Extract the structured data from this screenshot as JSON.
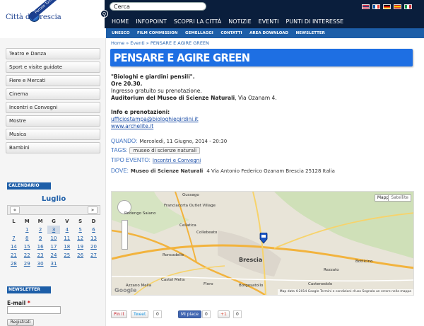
{
  "header": {
    "logo_text": "Città di   Brescia",
    "logo_ribbon": "Portale Turistico",
    "search_value": "Cerca",
    "languages": [
      "English",
      "Français",
      "Deutsch",
      "Español",
      "Italiano"
    ],
    "nav": [
      "HOME",
      "INFOPOINT",
      "SCOPRI LA CITTÀ",
      "NOTIZIE",
      "EVENTI",
      "PUNTI DI INTERESSE"
    ]
  },
  "subnav": [
    "UNESCO",
    "FILM COMMISSION",
    "GEMELLAGGI",
    "CONTATTI",
    "AREA DOWNLOAD",
    "NEWSLETTER"
  ],
  "breadcrumb": "Home » Eventi » PENSARE E AGIRE GREEN",
  "sidebar": {
    "menu": [
      "Teatro e Danza",
      "Sport e visite guidate",
      "Fiere e Mercati",
      "Cinema",
      "Incontri e Convegni",
      "Mostre",
      "Musica",
      "Bambini"
    ],
    "calendar_heading": "CALENDARIO",
    "month": "Luglio",
    "prev": "«",
    "next": "»",
    "weekdays": [
      "L",
      "M",
      "M",
      "G",
      "V",
      "S",
      "D"
    ],
    "weeks": [
      [
        "",
        "1",
        "2",
        "3",
        "4",
        "5",
        "6"
      ],
      [
        "7",
        "8",
        "9",
        "10",
        "11",
        "12",
        "13"
      ],
      [
        "14",
        "15",
        "16",
        "17",
        "18",
        "19",
        "20"
      ],
      [
        "21",
        "22",
        "23",
        "24",
        "25",
        "26",
        "27"
      ],
      [
        "28",
        "29",
        "30",
        "31",
        "",
        "",
        ""
      ]
    ],
    "newsletter_heading": "NEWSLETTER",
    "email_label": "E-mail",
    "email_required": "*",
    "register_label": "Registrati"
  },
  "event": {
    "title": "PENSARE E AGIRE GREEN",
    "line1": "\"Biologhi e giardini pensili\".",
    "line2": "Ore 20.30.",
    "line3": "Ingresso gratuito su prenotazione.",
    "venue_bold": "Auditorium del Museo di Scienze Naturali",
    "venue_rest": ", Via Ozanam 4.",
    "info_heading": "Info e prenotazioni:",
    "email": "ufficiostampa@biologhiegirdini.it",
    "website": "www.archelite.it",
    "when_label": "QUANDO:",
    "when_value": "Mercoledì, 11 Giugno, 2014 - 20:30",
    "tags_label": "TAGS:",
    "tag": "museo di scienze naturali",
    "type_label": "TIPO EVENTO:",
    "type_value": "Incontri e Convegni",
    "where_label": "DOVE:",
    "where_place": "Museo di Scienze Naturali",
    "where_address": "4 Via Antonio Federico Ozanam Brescia  25128 Italia"
  },
  "map": {
    "mode_map": "Mappe",
    "mode_satellite": "Satellite",
    "attribution": "Map data ©2014 Google    Termini e condizioni d'uso    Segnala un errore nella mappa",
    "places": [
      "Gussago",
      "Franciacorta Outlet Village",
      "Rodengo Saiano",
      "Cellatica",
      "Collebeato",
      "Brescia",
      "Roncadelle",
      "Castel Mella",
      "Flero",
      "Azzano Mella",
      "Rezzato",
      "Botticino",
      "Borgosatollo",
      "Castenedolo"
    ]
  },
  "share": {
    "pinit": "Pin it",
    "tweet": "Tweet",
    "tweet_count": "0",
    "like": "Mi piace",
    "like_count": "0",
    "plus": "+1",
    "plus_count": "0"
  }
}
